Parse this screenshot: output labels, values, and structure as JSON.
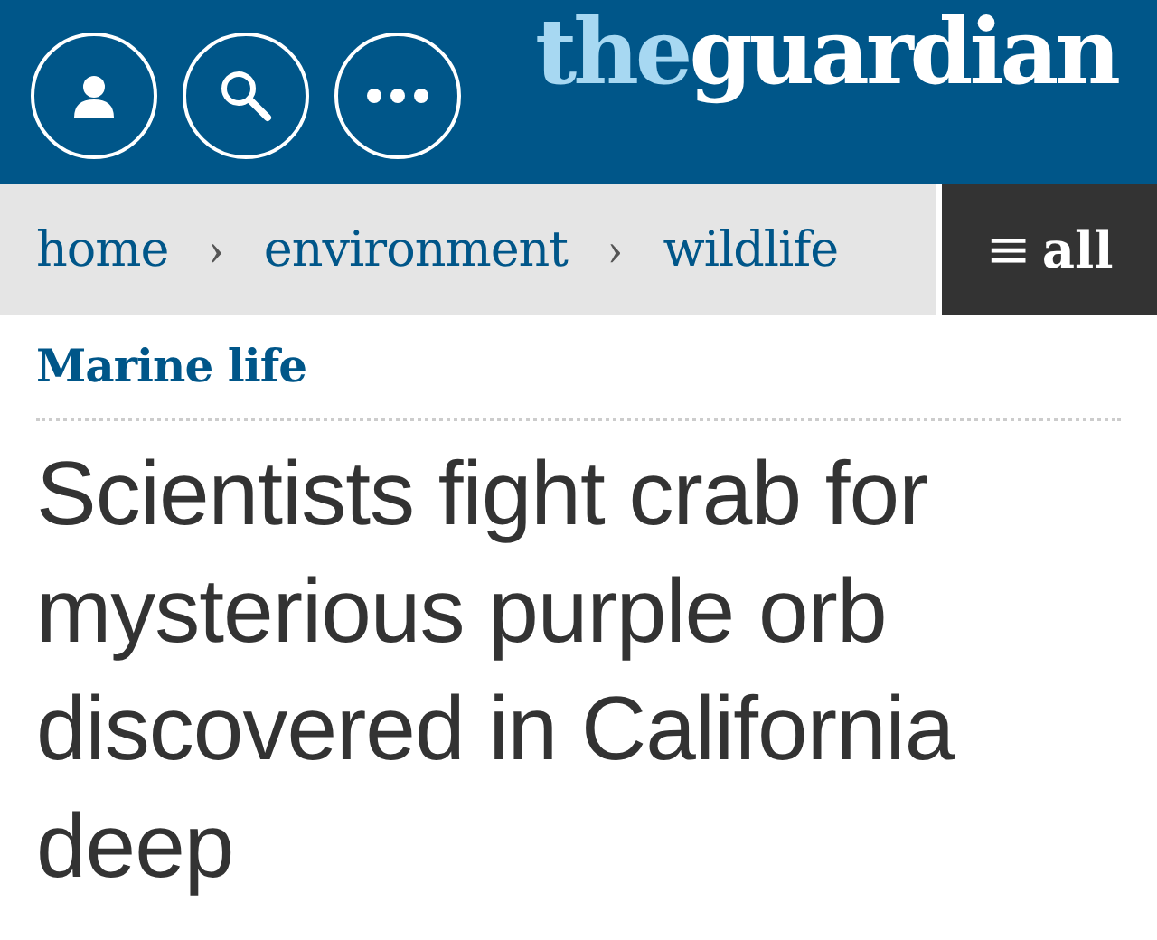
{
  "header": {
    "logo": {
      "prefix": "the",
      "name": "guardian"
    },
    "buttons": [
      {
        "kind": "profile"
      },
      {
        "kind": "search"
      },
      {
        "kind": "more"
      }
    ]
  },
  "breadcrumbs": {
    "items": [
      {
        "label": "home"
      },
      {
        "label": "environment"
      },
      {
        "label": "wildlife"
      }
    ],
    "separator": "›",
    "menu": {
      "icon": "≡",
      "label": "all"
    }
  },
  "article": {
    "section": "Marine life",
    "headline": "Scientists fight crab for mysterious purple orb discovered in California deep"
  }
}
